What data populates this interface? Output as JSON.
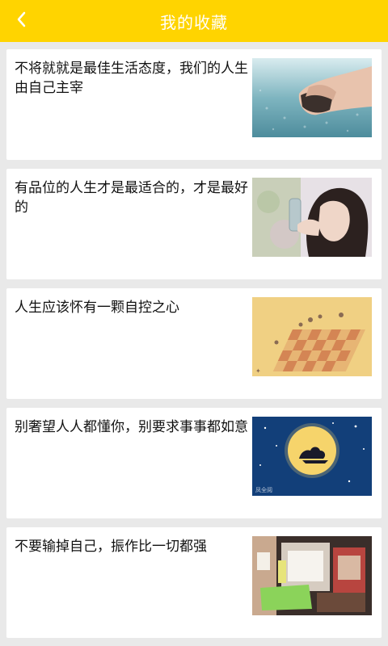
{
  "header": {
    "title": "我的收藏",
    "back_icon": "chevron-left-icon"
  },
  "favorites": [
    {
      "title": "不将就就是最佳生活态度，我们的人生由自己主宰",
      "image": "hands-holding-stone-over-water"
    },
    {
      "title": "有品位的人生才是最适合的，才是最好的",
      "image": "woman-with-bottle"
    },
    {
      "title": "人生应该怀有一颗自控之心",
      "image": "chess-board-illustration"
    },
    {
      "title": "别奢望人人都懂你，别要求事事都如意",
      "image": "full-moon-night-sky",
      "image_caption": "凤全阅"
    },
    {
      "title": "不要输掉自己，振作比一切都强",
      "image": "colorful-room-interior"
    }
  ],
  "colors": {
    "accent": "#ffd400",
    "background": "#e9e9e9",
    "card": "#ffffff",
    "text": "#111111"
  }
}
